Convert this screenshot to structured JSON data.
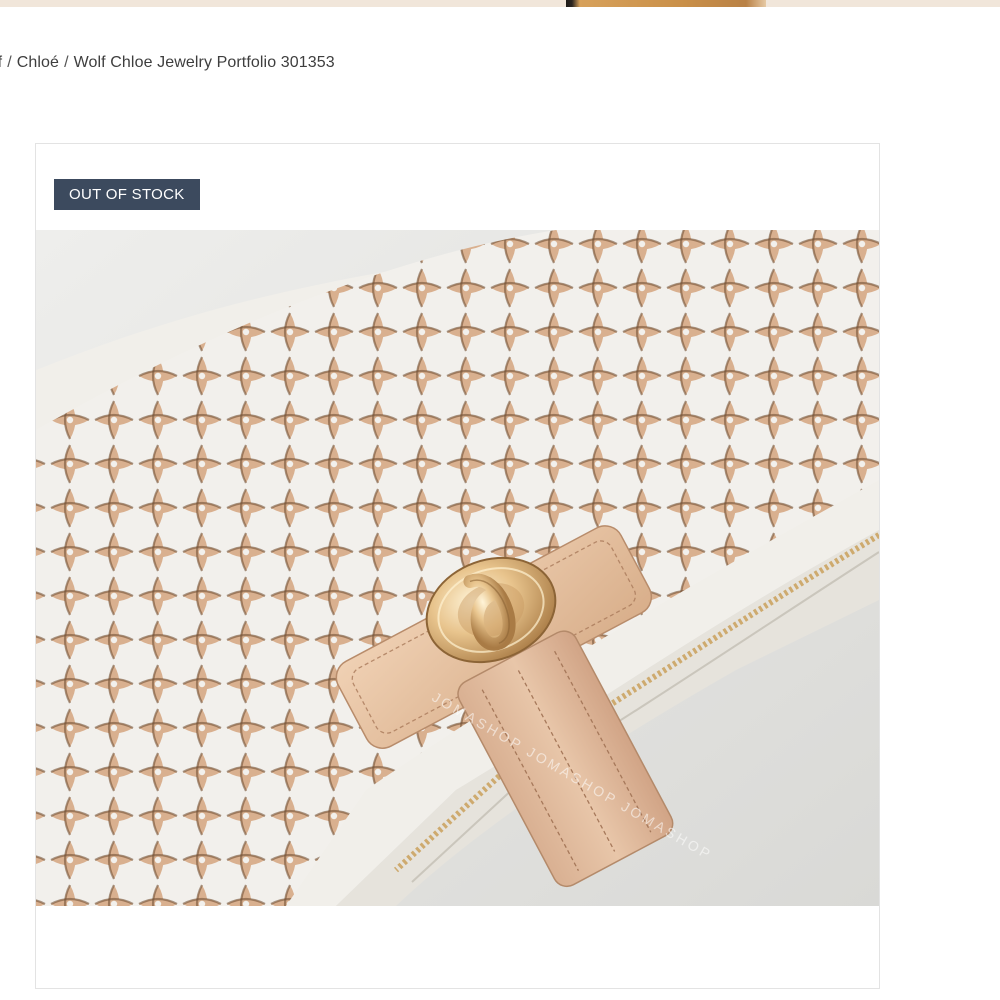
{
  "breadcrumb": {
    "items": [
      "lf",
      "Chloé",
      "Wolf Chloe Jewelry Portfolio 301353"
    ],
    "separator": "/"
  },
  "product": {
    "badge": "OUT OF STOCK",
    "image_watermark": "JOMASHOP JOMASHOP JOMASHOP"
  },
  "colors": {
    "badge_bg": "#3c4a5e",
    "leather_white": "#f3f1ed",
    "leather_nude": "#e2bb9a",
    "hardware_gold": "#d9b27c"
  }
}
